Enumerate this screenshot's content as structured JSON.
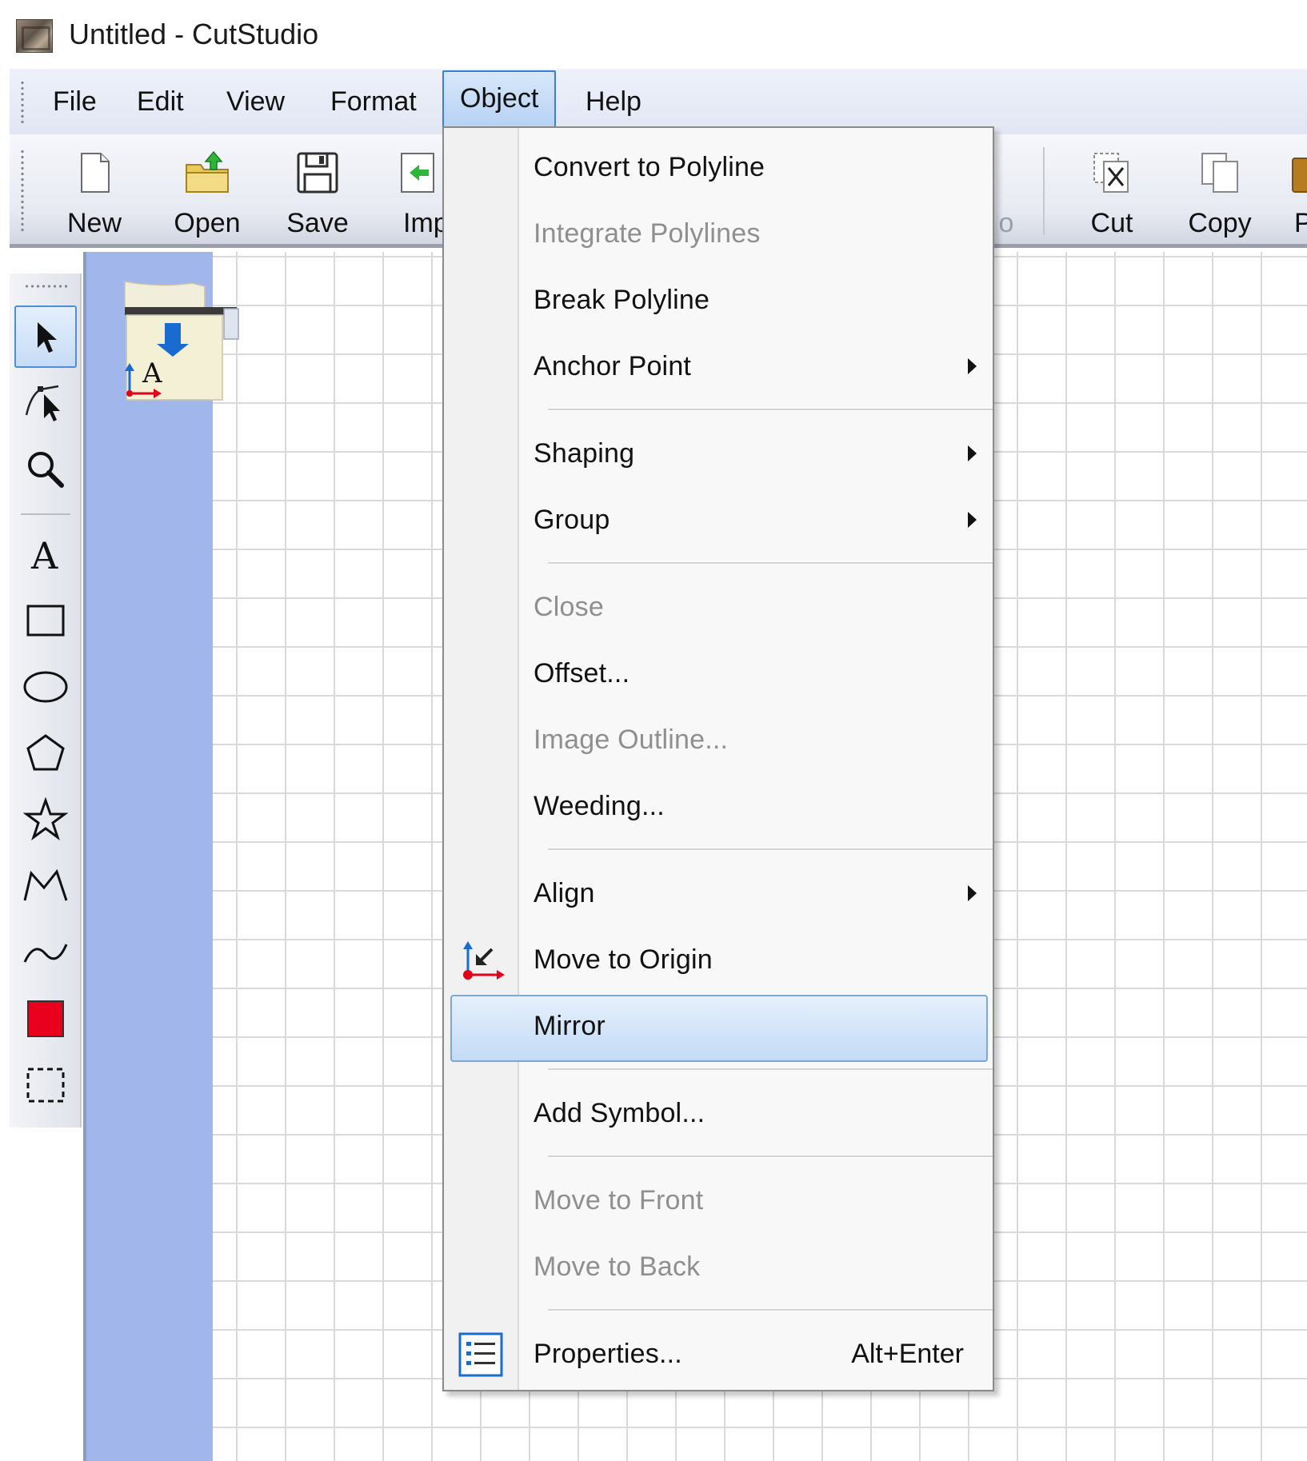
{
  "window": {
    "title": "Untitled - CutStudio",
    "icon": "cutstudio-app-icon"
  },
  "menubar": {
    "items": [
      {
        "label": "File"
      },
      {
        "label": "Edit"
      },
      {
        "label": "View"
      },
      {
        "label": "Format"
      },
      {
        "label": "Object",
        "state": "open"
      },
      {
        "label": "Help"
      }
    ]
  },
  "toolbar": {
    "buttons": [
      {
        "label": "New",
        "icon": "new-document-icon"
      },
      {
        "label": "Open",
        "icon": "open-folder-icon"
      },
      {
        "label": "Save",
        "icon": "save-floppy-icon"
      },
      {
        "label": "Imp",
        "icon": "import-icon"
      },
      {
        "label": "o",
        "icon": "partial-button"
      },
      {
        "label": "Cut",
        "icon": "cut-icon"
      },
      {
        "label": "Copy",
        "icon": "copy-icon"
      },
      {
        "label": "Pa",
        "icon": "paste-icon"
      }
    ]
  },
  "tools": [
    {
      "name": "select-arrow-icon",
      "active": true
    },
    {
      "name": "node-edit-icon"
    },
    {
      "name": "zoom-icon"
    },
    {
      "name": "text-tool-icon"
    },
    {
      "name": "rectangle-tool-icon"
    },
    {
      "name": "ellipse-tool-icon"
    },
    {
      "name": "polygon-tool-icon"
    },
    {
      "name": "star-tool-icon"
    },
    {
      "name": "polyline-tool-icon"
    },
    {
      "name": "curve-tool-icon"
    },
    {
      "name": "fill-color-icon",
      "color": "#e8001c"
    },
    {
      "name": "marquee-select-icon"
    }
  ],
  "object_menu": {
    "items": [
      {
        "label": "Convert to Polyline",
        "enabled": true
      },
      {
        "label": "Integrate Polylines",
        "enabled": false
      },
      {
        "label": "Break Polyline",
        "enabled": true
      },
      {
        "label": "Anchor Point",
        "enabled": true,
        "submenu": true
      },
      {
        "label": "Shaping",
        "enabled": true,
        "submenu": true
      },
      {
        "label": "Group",
        "enabled": true,
        "submenu": true
      },
      {
        "label": "Close",
        "enabled": false
      },
      {
        "label": "Offset...",
        "enabled": true
      },
      {
        "label": "Image Outline...",
        "enabled": false
      },
      {
        "label": "Weeding...",
        "enabled": true
      },
      {
        "label": "Align",
        "enabled": true,
        "submenu": true
      },
      {
        "label": "Move to Origin",
        "enabled": true,
        "icon": "move-to-origin-icon"
      },
      {
        "label": "Mirror",
        "enabled": true,
        "highlighted": true
      },
      {
        "label": "Add Symbol...",
        "enabled": true
      },
      {
        "label": "Move to Front",
        "enabled": false
      },
      {
        "label": "Move to Back",
        "enabled": false
      },
      {
        "label": "Properties...",
        "enabled": true,
        "shortcut": "Alt+Enter",
        "icon": "properties-list-icon"
      }
    ]
  },
  "colors": {
    "menu_highlight": "#c3dbf5",
    "canvas_strip": "#a1b7ec",
    "disabled_text": "#8f8f8f",
    "fill_swatch": "#e8001c"
  }
}
